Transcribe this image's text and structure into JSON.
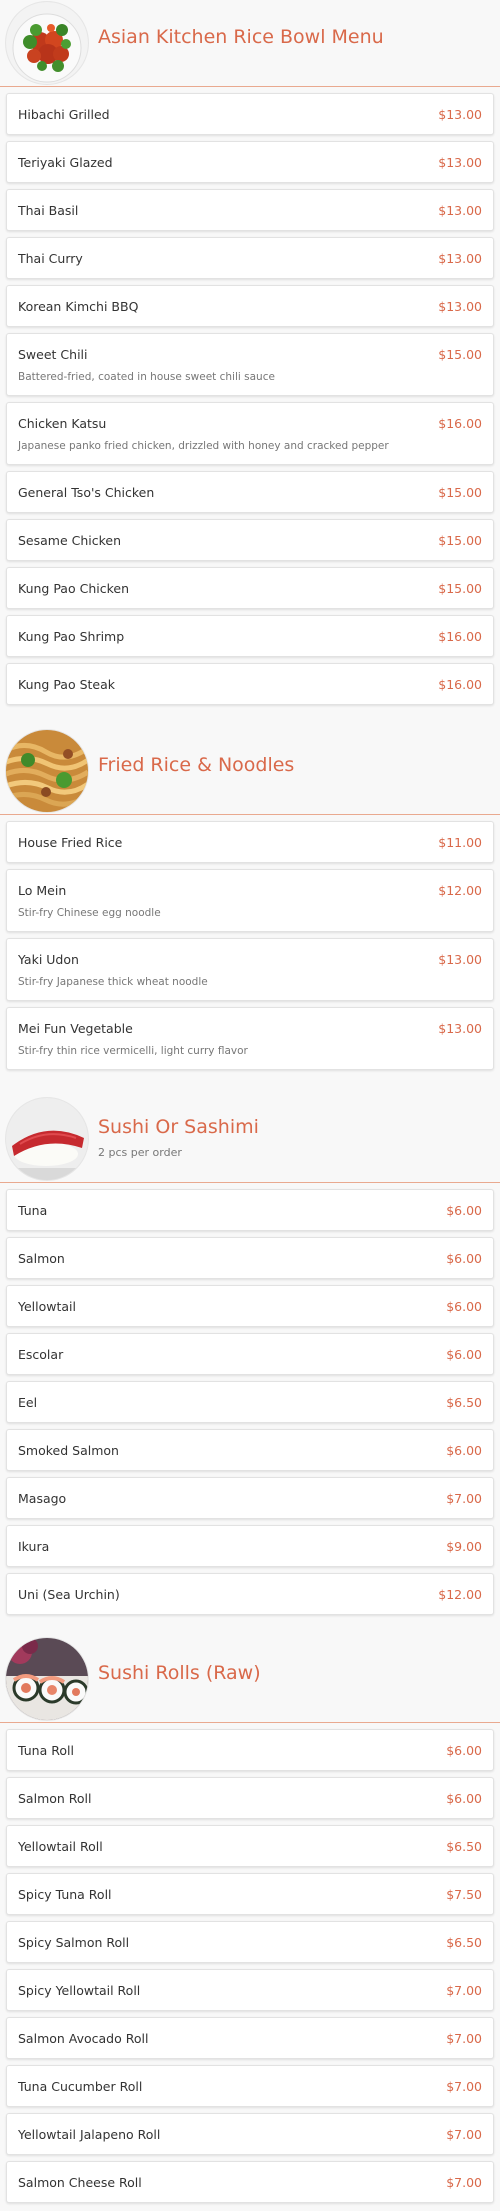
{
  "colors": {
    "accent": "#d9694a",
    "background": "#f8f8f8",
    "card": "#ffffff"
  },
  "sections": [
    {
      "title": "Asian Kitchen Rice Bowl Menu",
      "subtitle": "",
      "image": "orange-chicken-bowl-photo",
      "items": [
        {
          "name": "Hibachi Grilled",
          "price": "$13.00",
          "desc": ""
        },
        {
          "name": "Teriyaki Glazed",
          "price": "$13.00",
          "desc": ""
        },
        {
          "name": "Thai Basil",
          "price": "$13.00",
          "desc": ""
        },
        {
          "name": "Thai Curry",
          "price": "$13.00",
          "desc": ""
        },
        {
          "name": "Korean Kimchi BBQ",
          "price": "$13.00",
          "desc": ""
        },
        {
          "name": "Sweet Chili",
          "price": "$15.00",
          "desc": "Battered-fried, coated in house sweet chili sauce"
        },
        {
          "name": "Chicken Katsu",
          "price": "$16.00",
          "desc": "Japanese panko fried chicken, drizzled with honey and cracked pepper"
        },
        {
          "name": "General Tso's Chicken",
          "price": "$15.00",
          "desc": ""
        },
        {
          "name": "Sesame Chicken",
          "price": "$15.00",
          "desc": ""
        },
        {
          "name": "Kung Pao Chicken",
          "price": "$15.00",
          "desc": ""
        },
        {
          "name": "Kung Pao Shrimp",
          "price": "$16.00",
          "desc": ""
        },
        {
          "name": "Kung Pao Steak",
          "price": "$16.00",
          "desc": ""
        }
      ]
    },
    {
      "title": "Fried Rice & Noodles",
      "subtitle": "",
      "image": "lo-mein-noodles-photo",
      "items": [
        {
          "name": "House Fried Rice",
          "price": "$11.00",
          "desc": ""
        },
        {
          "name": "Lo Mein",
          "price": "$12.00",
          "desc": "Stir-fry Chinese egg noodle"
        },
        {
          "name": "Yaki Udon",
          "price": "$13.00",
          "desc": "Stir-fry Japanese thick wheat noodle"
        },
        {
          "name": "Mei Fun Vegetable",
          "price": "$13.00",
          "desc": "Stir-fry thin rice vermicelli, light curry flavor"
        }
      ]
    },
    {
      "title": "Sushi Or Sashimi",
      "subtitle": "2 pcs per order",
      "image": "tuna-nigiri-photo",
      "items": [
        {
          "name": "Tuna",
          "price": "$6.00",
          "desc": ""
        },
        {
          "name": "Salmon",
          "price": "$6.00",
          "desc": ""
        },
        {
          "name": "Yellowtail",
          "price": "$6.00",
          "desc": ""
        },
        {
          "name": "Escolar",
          "price": "$6.00",
          "desc": ""
        },
        {
          "name": "Eel",
          "price": "$6.50",
          "desc": ""
        },
        {
          "name": "Smoked Salmon",
          "price": "$6.00",
          "desc": ""
        },
        {
          "name": "Masago",
          "price": "$7.00",
          "desc": ""
        },
        {
          "name": "Ikura",
          "price": "$9.00",
          "desc": ""
        },
        {
          "name": "Uni (Sea Urchin)",
          "price": "$12.00",
          "desc": ""
        }
      ]
    },
    {
      "title": "Sushi Rolls (Raw)",
      "subtitle": "",
      "image": "sushi-rolls-photo",
      "items": [
        {
          "name": "Tuna Roll",
          "price": "$6.00",
          "desc": ""
        },
        {
          "name": "Salmon Roll",
          "price": "$6.00",
          "desc": ""
        },
        {
          "name": "Yellowtail Roll",
          "price": "$6.50",
          "desc": ""
        },
        {
          "name": "Spicy Tuna Roll",
          "price": "$7.50",
          "desc": ""
        },
        {
          "name": "Spicy Salmon Roll",
          "price": "$6.50",
          "desc": ""
        },
        {
          "name": "Spicy Yellowtail Roll",
          "price": "$7.00",
          "desc": ""
        },
        {
          "name": "Salmon Avocado Roll",
          "price": "$7.00",
          "desc": ""
        },
        {
          "name": "Tuna Cucumber Roll",
          "price": "$7.00",
          "desc": ""
        },
        {
          "name": "Yellowtail Jalapeno Roll",
          "price": "$7.00",
          "desc": ""
        },
        {
          "name": "Salmon Cheese Roll",
          "price": "$7.00",
          "desc": ""
        }
      ]
    }
  ]
}
